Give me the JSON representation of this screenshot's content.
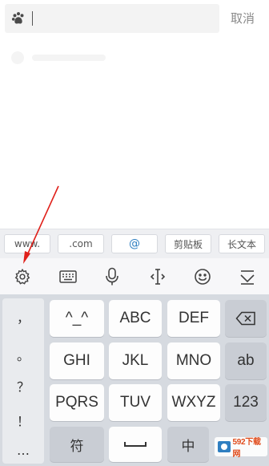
{
  "search": {
    "placeholder": "",
    "value": "",
    "cancel_label": "取消",
    "logo_icon": "paw-icon"
  },
  "quick_inputs": [
    "www.",
    ".com",
    "@",
    "剪贴板",
    "长文本"
  ],
  "toolbar": {
    "icons": [
      "gear-icon",
      "keyboard-icon",
      "microphone-icon",
      "cursor-icon",
      "emoji-icon",
      "collapse-icon"
    ]
  },
  "keyboard": {
    "symbols": [
      "，",
      "。",
      "？",
      "！",
      "…"
    ],
    "rows": [
      [
        "^_^",
        "ABC",
        "DEF"
      ],
      [
        "GHI",
        "JKL",
        "MNO"
      ],
      [
        "PQRS",
        "TUV",
        "WXYZ"
      ]
    ],
    "side_keys": [
      "backspace",
      "ab",
      "123"
    ],
    "bottom": {
      "symbol_key": "符",
      "lang_key": "中"
    }
  },
  "watermark": {
    "text": "592下载网"
  },
  "colors": {
    "annotation_arrow": "#e0201a",
    "at_accent": "#2f7fc1",
    "keyboard_bg": "#d6dae0"
  }
}
